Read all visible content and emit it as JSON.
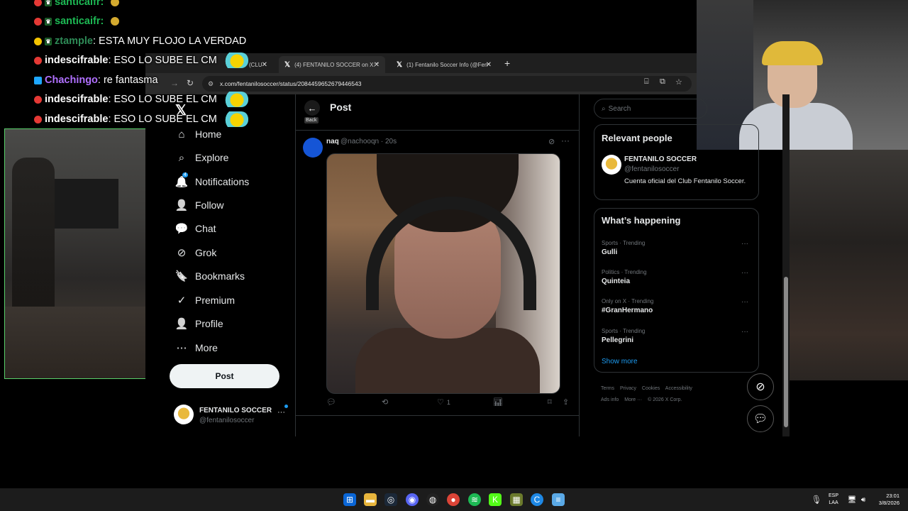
{
  "chat": {
    "lines": [
      {
        "user": "santicaifr:",
        "message": "",
        "user_color": "#1db954"
      },
      {
        "user": "santicaifr:",
        "message": "",
        "user_color": "#1db954"
      },
      {
        "user": "ztample",
        "message": ": ESTA MUY FLOJO LA VERDAD",
        "user_color": "#2e8b57"
      },
      {
        "user": "indescifrable",
        "message": ": ESO LO SUBE EL CM",
        "user_color": "#ffffff"
      },
      {
        "user": "Chachingo",
        "message": ": re fantasma",
        "user_color": "#b070ff"
      },
      {
        "user": "indescifrable",
        "message": ": ESO LO SUBE EL CM",
        "user_color": "#ffffff"
      },
      {
        "user": "indescifrable",
        "message": ": ESO LO SUBE EL CM",
        "user_color": "#ffffff"
      }
    ]
  },
  "browser": {
    "tabs": [
      {
        "label": "(CLU"
      },
      {
        "label": "(4) FENTANILO SOCCER on X: \""
      },
      {
        "label": "(1) Fentanilo Soccer Info (@Fen"
      }
    ],
    "new_tab": "+",
    "url": "x.com/fentanilosoccer/status/2084459652679446543"
  },
  "nav": {
    "logo": "𝕏",
    "items": [
      {
        "label": "Home",
        "icon": "⌂"
      },
      {
        "label": "Explore",
        "icon": "⌕"
      },
      {
        "label": "Notifications",
        "icon": "🔔"
      },
      {
        "label": "Follow",
        "icon": "👤"
      },
      {
        "label": "Chat",
        "icon": "💬"
      },
      {
        "label": "Grok",
        "icon": "⊘"
      },
      {
        "label": "Bookmarks",
        "icon": "🔖"
      },
      {
        "label": "Premium",
        "icon": "✓"
      },
      {
        "label": "Profile",
        "icon": "👤"
      },
      {
        "label": "More",
        "icon": "⋯"
      }
    ],
    "notification_badge": "4",
    "post_button": "Post",
    "profile": {
      "name": "FENTANILO SOCCER",
      "handle": "@fentanilosoccer",
      "more": "···"
    }
  },
  "main": {
    "title": "Post",
    "back_tooltip": "Back",
    "tweet": {
      "name": "naq",
      "meta": "@nachooqn · 20s",
      "like_count": "1"
    }
  },
  "sidebar": {
    "search_placeholder": "Search",
    "relevant_title": "Relevant people",
    "relevant_person": {
      "name": "FENTANILO SOCCER",
      "handle": "@fentanilosoccer",
      "bio": "Cuenta oficial del Club Fentanilo Soccer."
    },
    "happening_title": "What’s happening",
    "trends": [
      {
        "context": "Sports · Trending",
        "topic": "Gulli"
      },
      {
        "context": "Politics · Trending",
        "topic": "Quinteia"
      },
      {
        "context": "Only on X · Trending",
        "topic": "#GranHermano"
      },
      {
        "context": "Sports · Trending",
        "topic": "Pellegrini"
      }
    ],
    "show_more": "Show more",
    "footer": [
      "Terms",
      "Privacy",
      "Cookies",
      "Accessibility",
      "Ads info",
      "More ···",
      "© 2026 X Corp."
    ]
  },
  "taskbar": {
    "lang": "ESP",
    "lang2": "LAA",
    "time": "23:01",
    "date": "3/8/2026"
  },
  "colors": {
    "accent": "#1d9bf0",
    "border": "#2f3336",
    "muted_text": "#71767b"
  }
}
